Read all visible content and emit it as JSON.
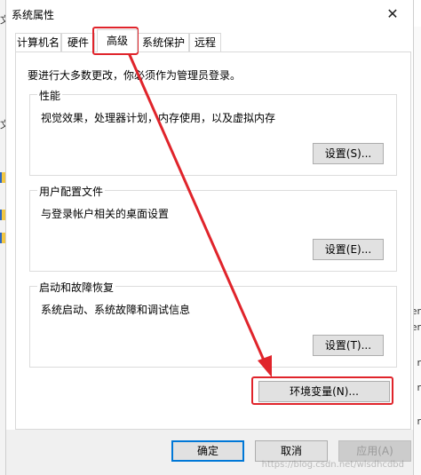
{
  "background": {
    "left_char_1": "文",
    "left_char_2": "文",
    "right_chars": [
      "er",
      "er",
      "r",
      "r",
      "r"
    ]
  },
  "dialog": {
    "title": "系统属性",
    "close_label": "✕"
  },
  "tabs": [
    {
      "label": "计算机名"
    },
    {
      "label": "硬件"
    },
    {
      "label": "高级"
    },
    {
      "label": "系统保护"
    },
    {
      "label": "远程"
    }
  ],
  "advanced": {
    "admin_note": "要进行大多数更改，你必须作为管理员登录。",
    "performance": {
      "legend": "性能",
      "description": "视觉效果，处理器计划，内存使用，以及虚拟内存",
      "settings_label": "设置(S)..."
    },
    "user_profiles": {
      "legend": "用户配置文件",
      "description": "与登录帐户相关的桌面设置",
      "settings_label": "设置(E)..."
    },
    "startup_recovery": {
      "legend": "启动和故障恢复",
      "description": "系统启动、系统故障和调试信息",
      "settings_label": "设置(T)..."
    },
    "env_vars_label": "环境变量(N)..."
  },
  "footer": {
    "ok_label": "确定",
    "cancel_label": "取消",
    "apply_label": "应用(A)"
  },
  "watermark": "https://blog.csdn.net/wlsdhcdbd",
  "colors": {
    "highlight_red": "#e0242b",
    "default_button_border": "#0078d7",
    "button_face": "#e1e1e1"
  }
}
